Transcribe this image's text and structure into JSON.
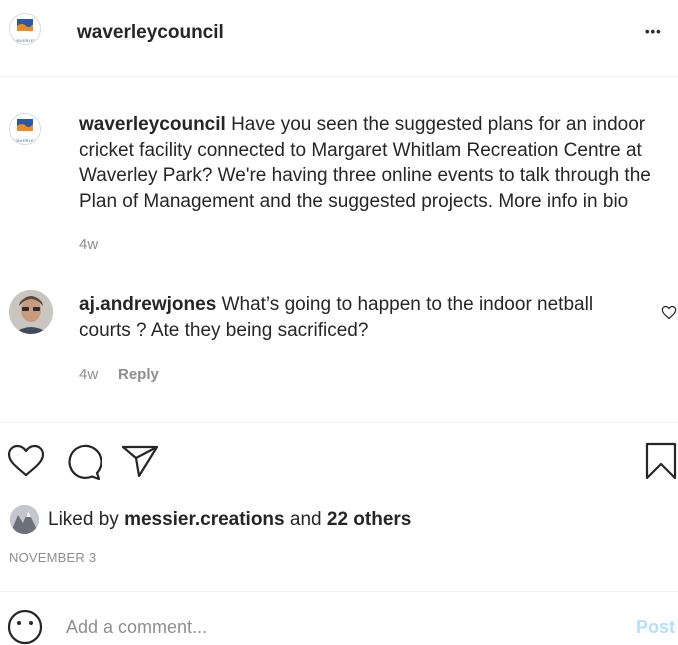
{
  "header": {
    "username": "waverleycouncil",
    "logo_text": "WAVERLEY",
    "more_label": "•••"
  },
  "caption": {
    "username": "waverleycouncil",
    "text": "Have you seen the suggested plans for an indoor cricket facility connected to Margaret Whitlam Recreation Centre at Waverley Park? We're having three online events to talk through the Plan of Management and the suggested projects. More info in bio",
    "time": "4w",
    "logo_text": "WAVERLEY"
  },
  "comment": {
    "username": "aj.andrewjones",
    "text": "What’s going to happen to the indoor netball courts ? Ate they being sacrificed?",
    "time": "4w",
    "reply_label": "Reply"
  },
  "likes": {
    "prefix": "Liked by",
    "user": "messier.creations",
    "and_text": "and",
    "others": "22 others"
  },
  "date": "NOVEMBER 3",
  "add_comment": {
    "placeholder": "Add a comment...",
    "post_label": "Post"
  },
  "icons": {
    "more": "more-options-icon",
    "like": "heart-icon",
    "comment": "comment-bubble-icon",
    "share": "share-paper-plane-icon",
    "save": "bookmark-icon",
    "comment_like": "small-heart-icon",
    "emoji": "emoji-smiley-icon"
  },
  "colors": {
    "link_blue": "#b2dffc",
    "meta_gray": "#8e8e8e",
    "logo_blue": "#2a5aa5",
    "logo_orange": "#f08a24"
  }
}
